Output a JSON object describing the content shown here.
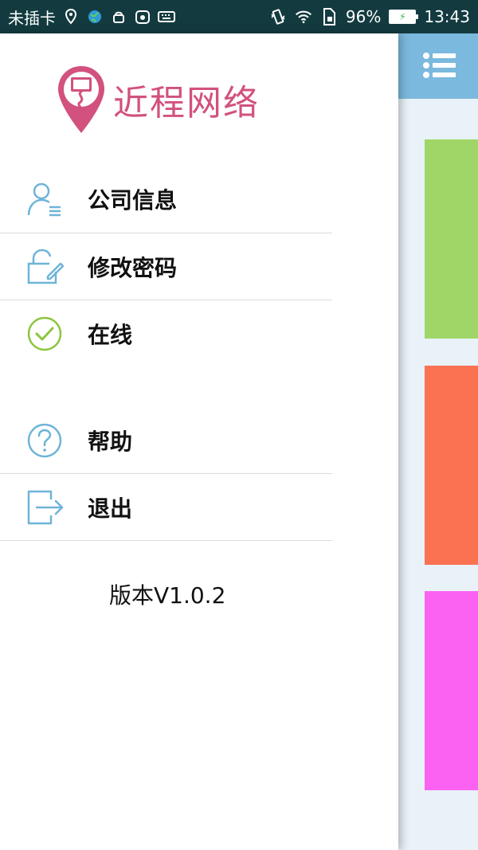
{
  "status_bar": {
    "carrier": "未插卡",
    "battery": "96%",
    "time": "13:43"
  },
  "drawer": {
    "logo_text": "近程网络",
    "menu_items": [
      {
        "label": "公司信息",
        "icon": "user-info-icon"
      },
      {
        "label": "修改密码",
        "icon": "lock-edit-icon"
      },
      {
        "label": "在线",
        "icon": "check-circle-icon"
      },
      {
        "label": "帮助",
        "icon": "help-circle-icon"
      },
      {
        "label": "退出",
        "icon": "exit-icon"
      }
    ],
    "version": "版本V1.0.2"
  },
  "main": {
    "menu_icon": "hamburger-menu-icon",
    "tiles": [
      {
        "color": "#9fd667"
      },
      {
        "color": "#fb7253"
      },
      {
        "color": "#fb62f1"
      }
    ]
  },
  "colors": {
    "status_bar": "#133b3f",
    "accent_logo": "#d2517f",
    "icon_blue": "#6fb4d8",
    "online_green": "#8cc63f",
    "topbar": "#7cb9de"
  }
}
